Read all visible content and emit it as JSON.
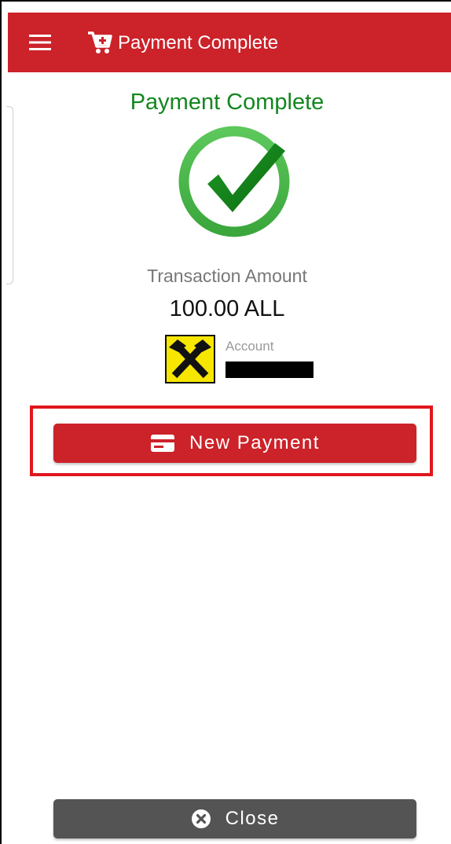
{
  "app_bar": {
    "title": "Payment Complete",
    "menu_icon": "menu-icon",
    "cart_icon": "cart-icon"
  },
  "status": {
    "title": "Payment Complete",
    "icon": "check-circle-icon"
  },
  "transaction": {
    "amount_label": "Transaction Amount",
    "amount_value": "100.00 ALL"
  },
  "account": {
    "label": "Account",
    "logo_icon": "bank-logo-icon",
    "value_redacted": true
  },
  "actions": {
    "new_payment_label": "New Payment",
    "new_payment_icon": "card-icon",
    "close_label": "Close",
    "close_icon": "close-circle-icon"
  },
  "colors": {
    "brand": "#cc2229",
    "success": "#13861e",
    "close_button": "#545454",
    "highlight": "#e0161e"
  }
}
